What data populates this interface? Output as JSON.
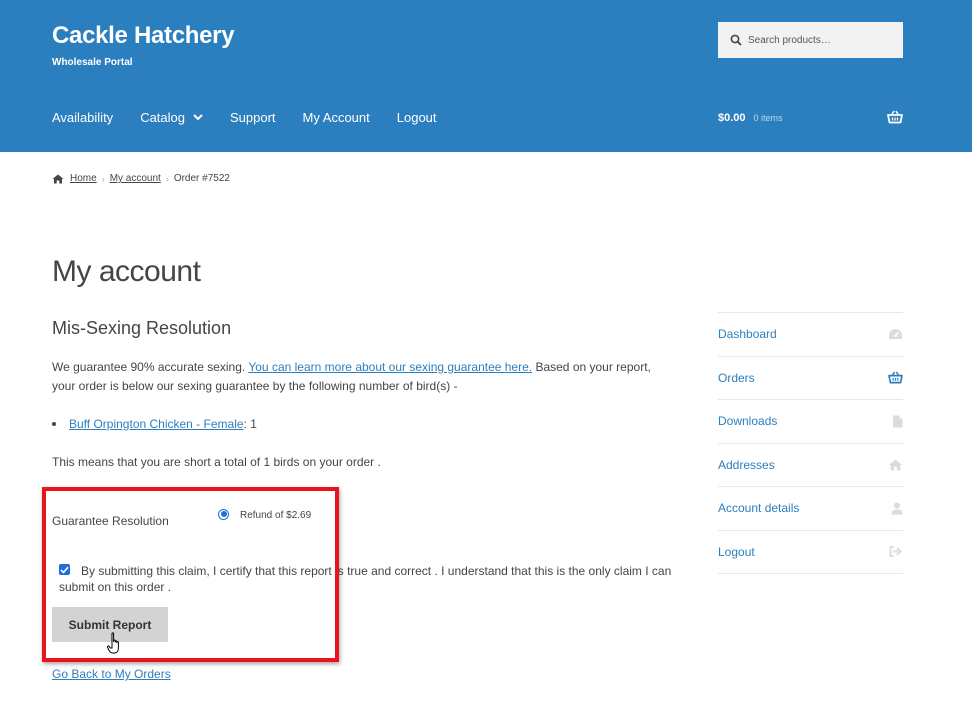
{
  "header": {
    "site_title": "Cackle Hatchery",
    "tagline": "Wholesale Portal",
    "search_placeholder": "Search products…",
    "nav": [
      "Availability",
      "Catalog",
      "Support",
      "My Account",
      "Logout"
    ],
    "cart_amount": "$0.00",
    "cart_count": "0 items"
  },
  "breadcrumb": {
    "home": "Home",
    "account": "My account",
    "current": "Order #7522"
  },
  "page_title": "My account",
  "section_title": "Mis-Sexing Resolution",
  "intro": {
    "text_before": "We guarantee 90% accurate sexing. ",
    "link": "You can learn more about our sexing guarantee here.",
    "text_after": " Based on your report, your order is below our sexing guarantee by the following number of bird(s) -"
  },
  "birds": [
    {
      "name": "Buff Orpington Chicken - Female",
      "count": " : 1"
    }
  ],
  "shortage_text": "This means that you are short a total of 1 birds on your order .",
  "form": {
    "guarantee_label": "Guarantee Resolution",
    "refund_option": "Refund of $2.69",
    "certify_text": "By submitting this claim, I certify that this report is true and correct . I understand that this is the only claim I can submit on this order .",
    "submit_label": "Submit Report"
  },
  "back_link": "Go Back to My Orders",
  "sidebar": {
    "items": [
      {
        "label": "Dashboard",
        "icon": "dashboard-icon"
      },
      {
        "label": "Orders",
        "icon": "basket-icon"
      },
      {
        "label": "Downloads",
        "icon": "file-icon"
      },
      {
        "label": "Addresses",
        "icon": "home-icon"
      },
      {
        "label": "Account details",
        "icon": "user-icon"
      },
      {
        "label": "Logout",
        "icon": "sign-out-icon"
      }
    ]
  },
  "colors": {
    "header_bg": "#2c7fbf",
    "link": "#2c7fbf",
    "highlight": "#e8141a"
  }
}
